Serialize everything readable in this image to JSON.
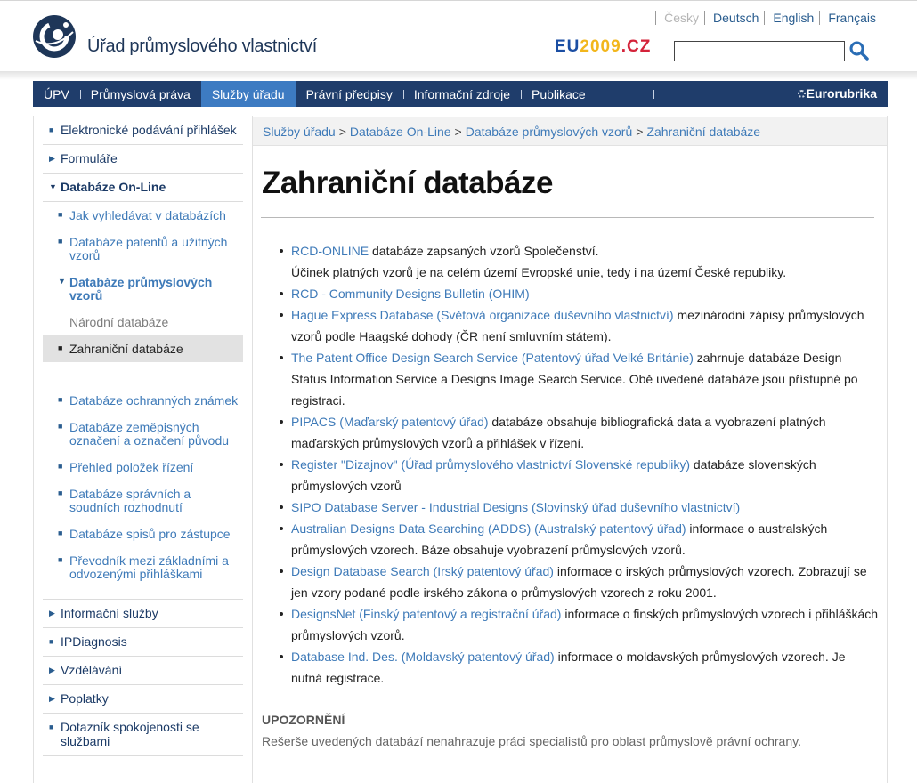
{
  "header": {
    "logo_text": "Úřad průmyslového vlastnictví",
    "eu_logo": {
      "part1": "EU",
      "part2": "2009",
      "part3": ".CZ"
    },
    "languages": [
      {
        "label": "Česky",
        "state": "disabled"
      },
      {
        "label": "Deutsch",
        "state": "link"
      },
      {
        "label": "English",
        "state": "link"
      },
      {
        "label": "Français",
        "state": "link"
      }
    ],
    "search": {
      "value": "",
      "placeholder": ""
    }
  },
  "mainnav": {
    "items": [
      {
        "label": "ÚPV"
      },
      {
        "label": "Průmyslová práva"
      },
      {
        "label": "Služby úřadu",
        "active": true
      },
      {
        "label": "Právní předpisy"
      },
      {
        "label": "Informační zdroje"
      },
      {
        "label": "Publikace"
      }
    ],
    "eurorubrika": "Eurorubrika"
  },
  "sidebar": {
    "top_items": [
      {
        "label": "Elektronické podávání přihlášek"
      },
      {
        "label": "Formuláře"
      },
      {
        "label": "Databáze On-Line",
        "expanded": true
      }
    ],
    "sub_items": [
      {
        "label": "Jak vyhledávat v databázích"
      },
      {
        "label": "Databáze patentů a užitných vzorů"
      },
      {
        "label": "Databáze průmyslových vzorů",
        "expanded": true
      },
      {
        "label": "Národní databáze"
      },
      {
        "label": "Zahraniční databáze",
        "current": true
      },
      {
        "label": "Databáze ochranných známek"
      },
      {
        "label": "Databáze zeměpisných označení a označení původu"
      },
      {
        "label": "Přehled položek řízení"
      },
      {
        "label": "Databáze správních a soudních rozhodnutí"
      },
      {
        "label": "Databáze spisů pro zástupce"
      },
      {
        "label": "Převodník mezi základními a odvozenými přihláškami"
      }
    ],
    "bottom_items": [
      {
        "label": "Informační služby"
      },
      {
        "label": "IPDiagnosis"
      },
      {
        "label": "Vzdělávání"
      },
      {
        "label": "Poplatky"
      },
      {
        "label": "Dotazník spokojenosti se službami"
      }
    ]
  },
  "breadcrumb": {
    "items": [
      "Služby úřadu",
      "Databáze On-Line",
      "Databáze průmyslových vzorů",
      "Zahraniční databáze"
    ],
    "separator": ">"
  },
  "page_title": "Zahraniční databáze",
  "databases": [
    {
      "link": "RCD-ONLINE",
      "text": " databáze zapsaných vzorů Společenství.",
      "extra": "Účinek platných vzorů je na celém území Evropské unie, tedy i na území České republiky."
    },
    {
      "link": "RCD - Community Designs Bulletin (OHIM)",
      "text": ""
    },
    {
      "link": "Hague Express Database (Světová organizace duševního vlastnictví)",
      "text": " mezinárodní zápisy průmyslových vzorů podle Haagské dohody (ČR není smluvním státem)."
    },
    {
      "link": "The Patent Office Design Search Service (Patentový úřad Velké Británie)",
      "text": " zahrnuje databáze Design Status Information Service a Designs Image Search Service. Obě uvedené databáze jsou přístupné po registraci."
    },
    {
      "link": "PIPACS (Maďarský patentový úřad)",
      "text": " databáze obsahuje bibliografická data a vyobrazení platných maďarských průmyslových vzorů a přihlášek v řízení."
    },
    {
      "link": "Register \"Dizajnov\" (Úřad průmyslového vlastnictví Slovenské republiky)",
      "text": " databáze slovenských průmyslových vzorů"
    },
    {
      "link": "SIPO Database Server - Industrial Designs (Slovinský úřad duševního vlastnictví)",
      "text": ""
    },
    {
      "link": "Australian Designs Data Searching (ADDS) (Australský patentový úřad)",
      "text": " informace o australských průmyslových vzorech. Báze obsahuje vyobrazení průmyslových vzorů."
    },
    {
      "link": "Design Database Search (Irský patentový úřad)",
      "text": " informace o irských průmyslových vzorech. Zobrazují se jen vzory podané podle irského zákona o průmyslových vzorech z roku 2001."
    },
    {
      "link": "DesignsNet (Finský patentový a registrační úřad)",
      "text": " informace o finských průmyslových vzorech i přihláškách průmyslových vzorů."
    },
    {
      "link": "Database Ind. Des. (Moldavský patentový úřad)",
      "text": " informace o moldavských průmyslových vzorech. Je nutná registrace."
    }
  ],
  "notice": {
    "heading": "UPOZORNĚNÍ",
    "text": "Rešerše uvedených databází nenahrazuje práci specialistů pro oblast průmyslově právní ochrany."
  },
  "colors": {
    "nav_bg": "#1f3d6b",
    "nav_active": "#3d7bc2",
    "link": "#3e7ab8",
    "sidebar_current_bg": "#e2e2e2"
  },
  "icons": {
    "logo": "upv-logo-icon",
    "search": "search-icon",
    "bullet": "square-bullet-icon"
  }
}
